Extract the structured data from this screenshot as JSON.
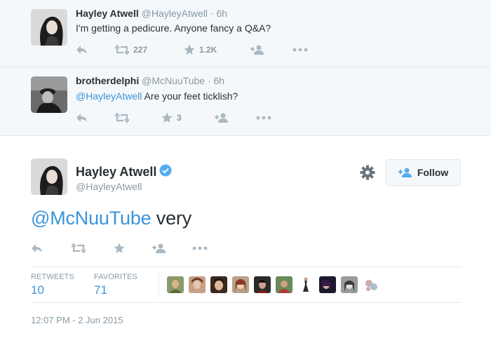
{
  "tweets": [
    {
      "name": "Hayley Atwell",
      "handle": "@HayleyAtwell",
      "time": "· 6h",
      "text": "I'm getting a pedicure. Anyone fancy a Q&A?",
      "retweets": "227",
      "favorites": "1.2K"
    },
    {
      "name": "brotherdelphi",
      "handle": "@McNuuTube",
      "time": "· 6h",
      "mention": "@HayleyAtwell",
      "text": " Are your feet ticklish?",
      "retweets": "",
      "favorites": "3"
    }
  ],
  "main_tweet": {
    "name": "Hayley Atwell",
    "handle": "@HayleyAtwell",
    "mention": "@McNuuTube",
    "text": " very",
    "follow_label": "Follow",
    "stats": {
      "retweets_label": "RETWEETS",
      "retweets_value": "10",
      "favorites_label": "FAVORITES",
      "favorites_value": "71"
    },
    "timestamp": "12:07 PM - 2 Jun 2015"
  },
  "colors": {
    "link": "#3b94d9",
    "icon": "#aab8c2",
    "muted": "#8899a6",
    "verified": "#55acee"
  },
  "icons": [
    "reply-icon",
    "retweet-icon",
    "favorite-icon",
    "follow-icon",
    "more-icon",
    "gear-icon",
    "verified-icon"
  ]
}
